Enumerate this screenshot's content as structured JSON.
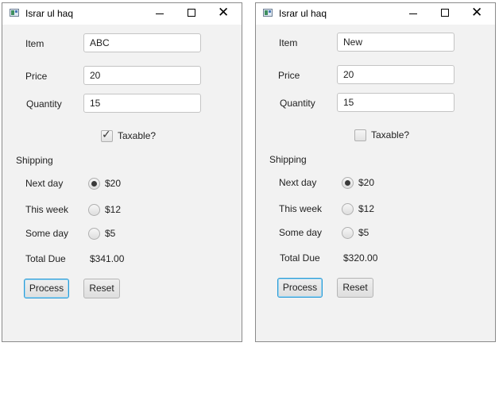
{
  "windows": [
    {
      "title": "Israr ul haq",
      "item_label": "Item",
      "item_value": "ABC",
      "price_label": "Price",
      "price_value": "20",
      "quantity_label": "Quantity",
      "quantity_value": "15",
      "taxable_label": "Taxable?",
      "taxable_checked": true,
      "check_glyph": "✓",
      "shipping_label": "Shipping",
      "shipping_options": [
        {
          "label": "Next day",
          "price": "$20",
          "selected": true
        },
        {
          "label": "This week",
          "price": "$12",
          "selected": false
        },
        {
          "label": "Some day",
          "price": "$5",
          "selected": false
        }
      ],
      "total_label": "Total Due",
      "total_value": "$341.00",
      "process_label": "Process",
      "reset_label": "Reset"
    },
    {
      "title": "Israr ul haq",
      "item_label": "Item",
      "item_value": "New",
      "price_label": "Price",
      "price_value": "20",
      "quantity_label": "Quantity",
      "quantity_value": "15",
      "taxable_label": "Taxable?",
      "taxable_checked": false,
      "check_glyph": "",
      "shipping_label": "Shipping",
      "shipping_options": [
        {
          "label": "Next day",
          "price": "$20",
          "selected": true
        },
        {
          "label": "This week",
          "price": "$12",
          "selected": false
        },
        {
          "label": "Some day",
          "price": "$5",
          "selected": false
        }
      ],
      "total_label": "Total Due",
      "total_value": "$320.00",
      "process_label": "Process",
      "reset_label": "Reset"
    }
  ],
  "icons": {
    "minimize": "minimize-icon",
    "maximize": "maximize-icon",
    "close": "close-icon",
    "close_glyph": "✕"
  },
  "colors": {
    "window_bg": "#f2f2f2",
    "focus_border": "#2a9bd6",
    "field_border": "#c4c4c4"
  }
}
